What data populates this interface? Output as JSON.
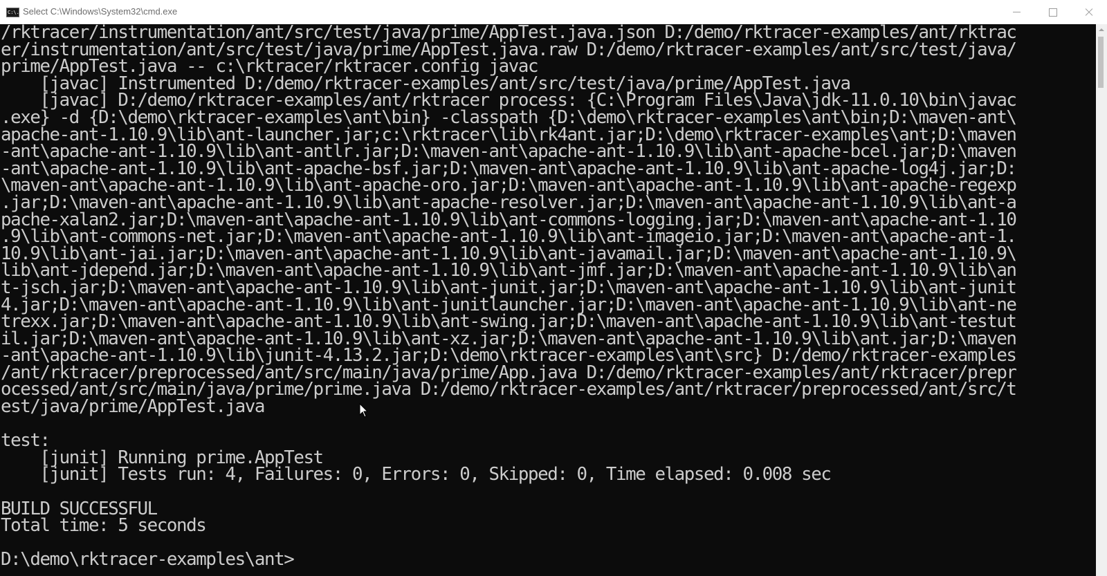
{
  "window": {
    "title": "Select C:\\Windows\\System32\\cmd.exe",
    "icon_text": "C:\\."
  },
  "console": {
    "lines": [
      "/rktracer/instrumentation/ant/src/test/java/prime/AppTest.java.json D:/demo/rktracer-examples/ant/rktrac",
      "er/instrumentation/ant/src/test/java/prime/AppTest.java.raw D:/demo/rktracer-examples/ant/src/test/java/",
      "prime/AppTest.java -- c:\\rktracer/rktracer.config javac",
      "    [javac] Instrumented D:/demo/rktracer-examples/ant/src/test/java/prime/AppTest.java",
      "    [javac] D:/demo/rktracer-examples/ant/rktracer process: {C:\\Program Files\\Java\\jdk-11.0.10\\bin\\javac",
      ".exe} -d {D:\\demo\\rktracer-examples\\ant\\bin} -classpath {D:\\demo\\rktracer-examples\\ant\\bin;D:\\maven-ant\\",
      "apache-ant-1.10.9\\lib\\ant-launcher.jar;c:\\rktracer\\lib\\rk4ant.jar;D:\\demo\\rktracer-examples\\ant;D:\\maven",
      "-ant\\apache-ant-1.10.9\\lib\\ant-antlr.jar;D:\\maven-ant\\apache-ant-1.10.9\\lib\\ant-apache-bcel.jar;D:\\maven",
      "-ant\\apache-ant-1.10.9\\lib\\ant-apache-bsf.jar;D:\\maven-ant\\apache-ant-1.10.9\\lib\\ant-apache-log4j.jar;D:",
      "\\maven-ant\\apache-ant-1.10.9\\lib\\ant-apache-oro.jar;D:\\maven-ant\\apache-ant-1.10.9\\lib\\ant-apache-regexp",
      ".jar;D:\\maven-ant\\apache-ant-1.10.9\\lib\\ant-apache-resolver.jar;D:\\maven-ant\\apache-ant-1.10.9\\lib\\ant-a",
      "pache-xalan2.jar;D:\\maven-ant\\apache-ant-1.10.9\\lib\\ant-commons-logging.jar;D:\\maven-ant\\apache-ant-1.10",
      ".9\\lib\\ant-commons-net.jar;D:\\maven-ant\\apache-ant-1.10.9\\lib\\ant-imageio.jar;D:\\maven-ant\\apache-ant-1.",
      "10.9\\lib\\ant-jai.jar;D:\\maven-ant\\apache-ant-1.10.9\\lib\\ant-javamail.jar;D:\\maven-ant\\apache-ant-1.10.9\\",
      "lib\\ant-jdepend.jar;D:\\maven-ant\\apache-ant-1.10.9\\lib\\ant-jmf.jar;D:\\maven-ant\\apache-ant-1.10.9\\lib\\an",
      "t-jsch.jar;D:\\maven-ant\\apache-ant-1.10.9\\lib\\ant-junit.jar;D:\\maven-ant\\apache-ant-1.10.9\\lib\\ant-junit",
      "4.jar;D:\\maven-ant\\apache-ant-1.10.9\\lib\\ant-junitlauncher.jar;D:\\maven-ant\\apache-ant-1.10.9\\lib\\ant-ne",
      "trexx.jar;D:\\maven-ant\\apache-ant-1.10.9\\lib\\ant-swing.jar;D:\\maven-ant\\apache-ant-1.10.9\\lib\\ant-testut",
      "il.jar;D:\\maven-ant\\apache-ant-1.10.9\\lib\\ant-xz.jar;D:\\maven-ant\\apache-ant-1.10.9\\lib\\ant.jar;D:\\maven",
      "-ant\\apache-ant-1.10.9\\lib\\junit-4.13.2.jar;D:\\demo\\rktracer-examples\\ant\\src} D:/demo/rktracer-examples",
      "/ant/rktracer/preprocessed/ant/src/main/java/prime/App.java D:/demo/rktracer-examples/ant/rktracer/prepr",
      "ocessed/ant/src/main/java/prime/prime.java D:/demo/rktracer-examples/ant/rktracer/preprocessed/ant/src/t",
      "est/java/prime/AppTest.java",
      "",
      "test:",
      "    [junit] Running prime.AppTest",
      "    [junit] Tests run: 4, Failures: 0, Errors: 0, Skipped: 0, Time elapsed: 0.008 sec",
      "",
      "BUILD SUCCESSFUL",
      "Total time: 5 seconds",
      "",
      "D:\\demo\\rktracer-examples\\ant>"
    ]
  },
  "colors": {
    "console_bg": "#0c0c0c",
    "console_fg": "#cccccc",
    "titlebar_bg": "#ffffff"
  }
}
